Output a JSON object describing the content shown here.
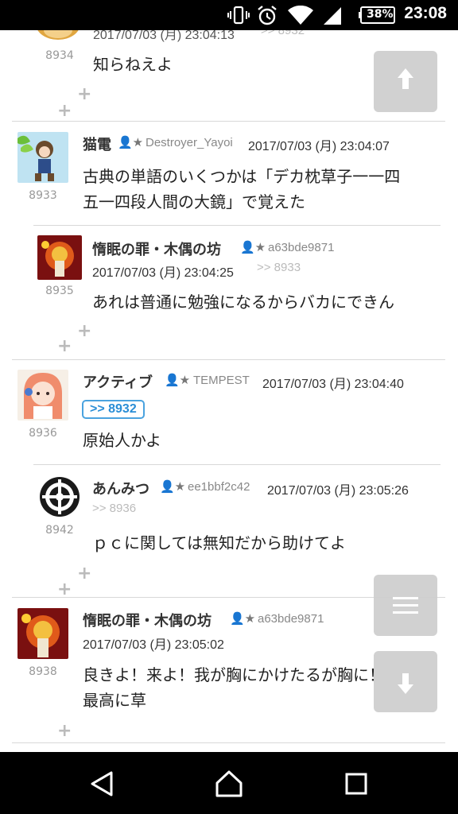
{
  "status_bar": {
    "battery_percent": "38%",
    "time": "23:08",
    "icons": [
      "vibrate-icon",
      "alarm-icon",
      "wifi-icon",
      "signal-icon",
      "battery-icon"
    ]
  },
  "posts": [
    {
      "num": "8934",
      "date_partial": "2017/07/03 (月) 23:04:13",
      "reply_partial": ">> 8932",
      "body": "知らねえよ"
    },
    {
      "num": "8933",
      "name": "猫電",
      "uid": "Destroyer_Yayoi",
      "date": "2017/07/03 (月) 23:04:07",
      "body_lines": [
        "古典の単語のいくつかは「デカ枕草子一一四",
        "五一四段人間の大鏡」で覚えた"
      ]
    },
    {
      "num": "8935",
      "name": "惰眠の罪・木偶の坊",
      "uid": "a63bde9871",
      "date": "2017/07/03 (月) 23:04:25",
      "reply": ">> 8933",
      "body": "あれは普通に勉強になるからバカにできん"
    },
    {
      "num": "8936",
      "name": "アクティブ",
      "uid": "TEMPEST",
      "date": "2017/07/03 (月) 23:04:40",
      "quote": ">> 8932",
      "body": "原始人かよ"
    },
    {
      "num": "8942",
      "name": "あんみつ",
      "uid": "ee1bbf2c42",
      "date": "2017/07/03 (月) 23:05:26",
      "reply": ">> 8936",
      "body": "ｐｃに関しては無知だから助けてよ"
    },
    {
      "num": "8938",
      "name": "惰眠の罪・木偶の坊",
      "uid": "a63bde9871",
      "date": "2017/07/03 (月) 23:05:02",
      "body_lines": [
        "良きよ！来よ！我が胸にかけたるが胸に！",
        "最高に草"
      ]
    }
  ],
  "plus_label": "+",
  "colors": {
    "accent": "#4aa3df",
    "fab": "#cfcfcf",
    "divider": "#d8d8d8"
  }
}
